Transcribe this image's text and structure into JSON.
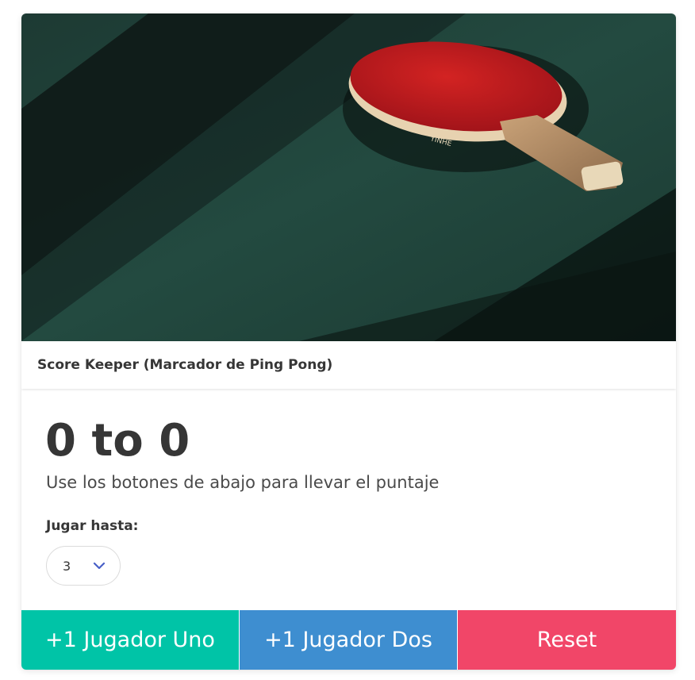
{
  "card": {
    "title": "Score Keeper (Marcador de Ping Pong)",
    "image_alt": "ping-pong-paddle-on-table"
  },
  "score": {
    "text": "0 to 0",
    "player1": 0,
    "player2": 0,
    "subtitle": "Use los botones de abajo para llevar el puntaje"
  },
  "settings": {
    "label": "Jugar hasta:",
    "selected": "3"
  },
  "buttons": {
    "player_one": "+1 Jugador Uno",
    "player_two": "+1 Jugador Dos",
    "reset": "Reset"
  },
  "colors": {
    "primary": "#00c4a7",
    "info": "#3e8ed0",
    "danger": "#f14668",
    "chevron": "#485fc7"
  }
}
